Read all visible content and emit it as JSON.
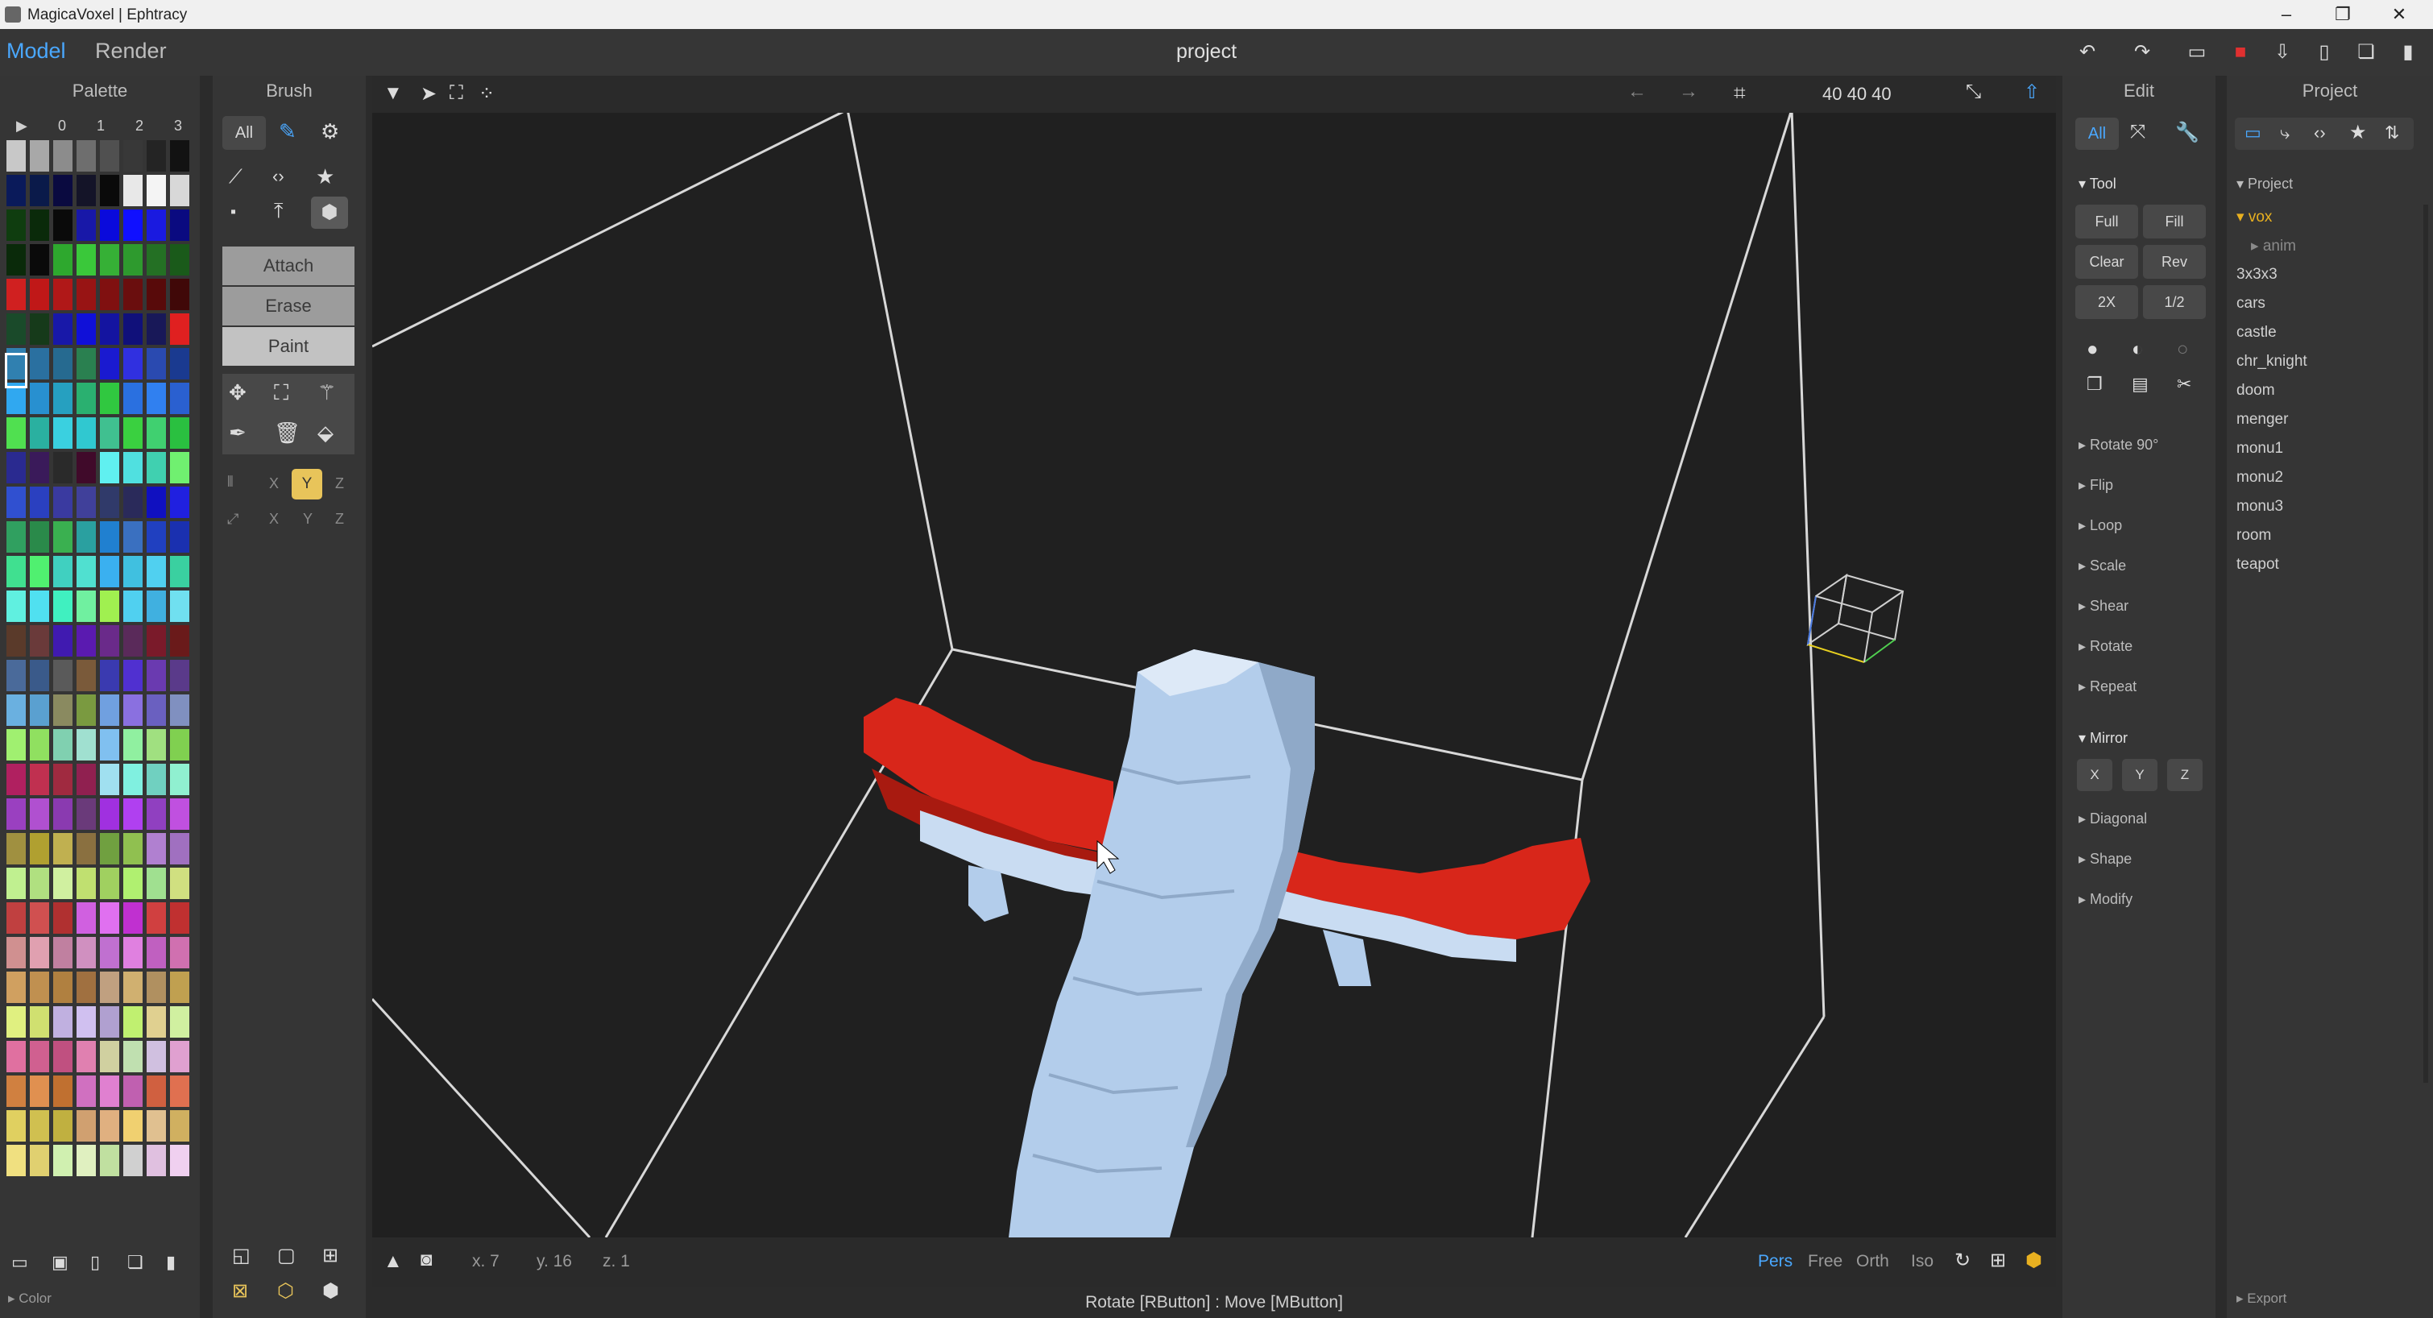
{
  "window": {
    "title": "MagicaVoxel | Ephtracy"
  },
  "topbar": {
    "mode_model": "Model",
    "mode_render": "Render",
    "project_name": "project"
  },
  "palette": {
    "header": "Palette",
    "columns": [
      "0",
      "1",
      "2",
      "3"
    ],
    "footer_label": "Color",
    "colors": [
      [
        "#c8c8c8",
        "#a8a8a8",
        "#8c8c8c",
        "#6e6e6e",
        "#505050",
        "#383838",
        "#242424",
        "#121212"
      ],
      [
        "#0a1a5a",
        "#0a1a4a",
        "#0a0a40",
        "#141428",
        "#0a0a0a",
        "#e8e8e8",
        "#f4f4f4",
        "#d8d8d8"
      ],
      [
        "#0f3d0f",
        "#0a2a0a",
        "#0a0a0a",
        "#1818a8",
        "#0a0adc",
        "#1010ff",
        "#1a1ae0",
        "#0a0a80"
      ],
      [
        "#0a2a0a",
        "#0a0a0a",
        "#2ea82e",
        "#3ac83a",
        "#36b036",
        "#2e9a2e",
        "#247024",
        "#1a5a1a"
      ],
      [
        "#d02020",
        "#c01818",
        "#b01818",
        "#981414",
        "#801010",
        "#6a0e0e",
        "#580a0a",
        "#400808"
      ],
      [
        "#1a4a2a",
        "#163a1a",
        "#1818a8",
        "#1010d8",
        "#1414a0",
        "#10107a",
        "#181858",
        "#e02020"
      ],
      [
        "#3080b0",
        "#2a70a0",
        "#266a90",
        "#2a8050",
        "#1a1ad0",
        "#3030e0",
        "#2a4ab0",
        "#1a3a90"
      ],
      [
        "#30a8f0",
        "#2890d0",
        "#26a0c0",
        "#2ab070",
        "#30c840",
        "#2a70e0",
        "#3080f0",
        "#2a60d0"
      ],
      [
        "#50e050",
        "#2ab0a0",
        "#3ad0e0",
        "#30c8d0",
        "#40c090",
        "#3ad040",
        "#40d070",
        "#2ac040"
      ],
      [
        "#2a2a90",
        "#3a1a5a",
        "#2a2a2a",
        "#400a2a",
        "#60f0f0",
        "#50e0e0",
        "#40d0b0",
        "#70f070"
      ],
      [
        "#3050d0",
        "#2a40c0",
        "#3a3aa0",
        "#40409a",
        "#303a6a",
        "#2a2a5a",
        "#1010c0",
        "#2020e0"
      ],
      [
        "#30a060",
        "#2a8a4a",
        "#3ab050",
        "#2aa0a0",
        "#2080d0",
        "#3a70c0",
        "#2040c0",
        "#1a30b0"
      ],
      [
        "#40e090",
        "#50f070",
        "#40d0c0",
        "#50e0d0",
        "#3ab0f0",
        "#40c0e0",
        "#50d0f0",
        "#3ad0a0"
      ],
      [
        "#60f0e0",
        "#50e0f0",
        "#40f0c0",
        "#70f0a0",
        "#a0f050",
        "#50d0f0",
        "#40b0e0",
        "#70e0f0"
      ],
      [
        "#5a3a2a",
        "#6a3a3a",
        "#401ab0",
        "#5a1ab0",
        "#6a2a8a",
        "#5a2a5a",
        "#7a1a2a",
        "#6a1a1a"
      ],
      [
        "#4a6a9a",
        "#3a5a8a",
        "#5a5a5a",
        "#7a5a3a",
        "#3a3ab0",
        "#5030d0",
        "#6a3ab0",
        "#5a3a8a"
      ],
      [
        "#6ab0e0",
        "#5aa0d0",
        "#8a8a60",
        "#7a9a40",
        "#70a0e0",
        "#8a70e0",
        "#6a60c0",
        "#8090c0"
      ],
      [
        "#a0f070",
        "#90e060",
        "#80d0b0",
        "#a0e0d0",
        "#80c0f0",
        "#90f0a0",
        "#a0e080",
        "#80d050"
      ],
      [
        "#b02060",
        "#c03050",
        "#a02a40",
        "#902050",
        "#a0e0f0",
        "#80f0e0",
        "#70d0c0",
        "#90f0d0"
      ],
      [
        "#9a40c0",
        "#b050d0",
        "#8a3ab0",
        "#6a3a7a",
        "#a030e0",
        "#b040f0",
        "#9040c0",
        "#c050e0"
      ],
      [
        "#a09040",
        "#b0a030",
        "#c0b050",
        "#8a7040",
        "#70a040",
        "#90c050",
        "#b080d0",
        "#a070c0"
      ],
      [
        "#c0f090",
        "#b0e080",
        "#d0f0a0",
        "#c0e070",
        "#a0d060",
        "#b0f070",
        "#a0e090",
        "#d0e080"
      ],
      [
        "#c04040",
        "#d05050",
        "#b03030",
        "#d060e0",
        "#e070f0",
        "#c030d0",
        "#d04040",
        "#c03030"
      ],
      [
        "#d09090",
        "#e0a0b0",
        "#c080a0",
        "#d090c0",
        "#c070d0",
        "#e080e0",
        "#c060c0",
        "#d070b0"
      ],
      [
        "#d0a060",
        "#c09050",
        "#b08040",
        "#a07040",
        "#c0a080",
        "#d0b070",
        "#b09060",
        "#c0a050"
      ],
      [
        "#e0f080",
        "#d0e070",
        "#c0b0e0",
        "#d0c0f0",
        "#b0a0d0",
        "#c0f070",
        "#e0d090",
        "#d0f0a0"
      ],
      [
        "#e070a0",
        "#d06090",
        "#c05080",
        "#e080b0",
        "#d0d0a0",
        "#c0e0b0",
        "#d0c0e0",
        "#e0a0d0"
      ],
      [
        "#d08040",
        "#e09050",
        "#c07030",
        "#d070c0",
        "#e080d0",
        "#c060b0",
        "#d06040",
        "#e07050"
      ],
      [
        "#e0d060",
        "#d0c050",
        "#c0b040",
        "#d0a070",
        "#e0b080",
        "#f0d070",
        "#e0c090",
        "#d0b060"
      ],
      [
        "#f0e080",
        "#e0d070",
        "#d0f0b0",
        "#e0f0c0",
        "#c0e0a0",
        "#d0d0d0",
        "#e0c0e0",
        "#f0d0f0"
      ]
    ],
    "bottom_icons": [
      "open-icon",
      "save-icon",
      "new-icon",
      "copy-icon",
      "paste-icon"
    ]
  },
  "brush": {
    "header": "Brush",
    "tab_all": "All",
    "modes": {
      "attach": "Attach",
      "erase": "Erase",
      "paint": "Paint"
    },
    "mirror_axes": [
      "X",
      "Y",
      "Z"
    ],
    "flip_axes": [
      "X",
      "Y",
      "Z"
    ],
    "active_axis": "Y"
  },
  "viewport": {
    "dims": "40  40  40",
    "coords": {
      "x": "x. 7",
      "y": "y. 16",
      "z": "z. 1"
    },
    "view_modes": [
      "Pers",
      "Free",
      "Orth",
      "Iso"
    ],
    "active_view": "Pers",
    "hint": "Rotate [RButton] : Move [MButton]",
    "colors": {
      "voxel": "#b3cdeb",
      "voxel_shade": "#8fa9c8",
      "wing": "#d8261a",
      "wing_shade": "#a81a10",
      "box_line": "#d8d8d8",
      "bg": "#202020"
    }
  },
  "edit": {
    "header": "Edit",
    "tab_all": "All",
    "tool_label": "Tool",
    "buttons": [
      "Full",
      "Fill",
      "Clear",
      "Rev",
      "2X",
      "1/2"
    ],
    "sections": [
      "Rotate 90°",
      "Flip",
      "Loop",
      "Scale",
      "Shear",
      "Rotate",
      "Repeat"
    ],
    "mirror_label": "Mirror",
    "mirror_axes": [
      "X",
      "Y",
      "Z"
    ],
    "sections2": [
      "Diagonal",
      "Shape",
      "Modify"
    ]
  },
  "project": {
    "header": "Project",
    "tree_label": "Project",
    "folder": "vox",
    "subfolder": "anim",
    "files": [
      "3x3x3",
      "cars",
      "castle",
      "chr_knight",
      "doom",
      "menger",
      "monu1",
      "monu2",
      "monu3",
      "room",
      "teapot"
    ],
    "export_label": "Export"
  },
  "colors": {
    "accent": "#4aa8ff",
    "selected_axis": "#e8c45a",
    "save_red": "#e03030",
    "folder_yellow": "#e8b020"
  }
}
